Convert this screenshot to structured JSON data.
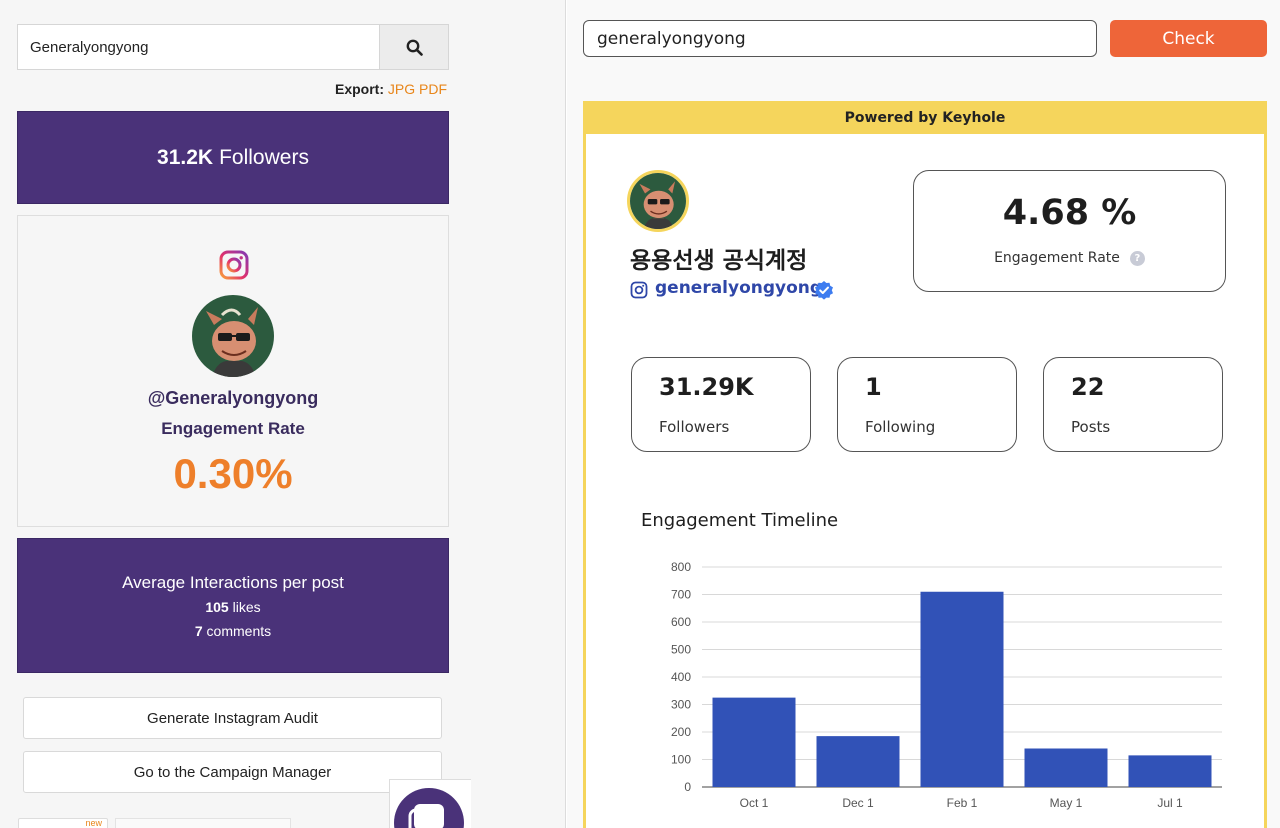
{
  "left": {
    "search": {
      "value": "Generalyongyong"
    },
    "export": {
      "label": "Export:",
      "jpg": "JPG",
      "pdf": "PDF"
    },
    "followers": {
      "count": "31.2K",
      "label": "Followers"
    },
    "profile": {
      "handle": "@Generalyongyong",
      "engagement_label": "Engagement Rate",
      "engagement_value": "0.30%"
    },
    "average": {
      "title": "Average Interactions per post",
      "likes_count": "105",
      "likes_label": "likes",
      "comments_count": "7",
      "comments_label": "comments"
    },
    "buttons": {
      "audit": "Generate Instagram Audit",
      "campaign": "Go to the Campaign Manager"
    },
    "new_tag": "new"
  },
  "right": {
    "search": {
      "value": "generalyongyong"
    },
    "check_label": "Check",
    "widget": {
      "powered_by": "Powered by Keyhole",
      "display_name": "용용선생 공식계정",
      "username": "generalyongyong",
      "engagement": {
        "value": "4.68 %",
        "label": "Engagement Rate",
        "help": "?"
      },
      "stats": [
        {
          "value": "31.29K",
          "label": "Followers"
        },
        {
          "value": "1",
          "label": "Following"
        },
        {
          "value": "22",
          "label": "Posts"
        }
      ],
      "timeline_title": "Engagement Timeline"
    }
  },
  "colors": {
    "purple": "#4a3279",
    "orange": "#ee7f2a",
    "check_button": "#ee6539",
    "keyhole_yellow": "#f5d55c",
    "bar_blue": "#3152b7",
    "link_blue": "#2f47a8"
  },
  "chart_data": {
    "type": "bar",
    "categories": [
      "Oct 1",
      "Dec 1",
      "Feb 1",
      "May 1",
      "Jul 1"
    ],
    "values": [
      325,
      185,
      710,
      140,
      115
    ],
    "ylim": [
      0,
      800
    ],
    "yticks": [
      0,
      100,
      200,
      300,
      400,
      500,
      600,
      700,
      800
    ],
    "grid": true,
    "color": "#3152b7"
  }
}
